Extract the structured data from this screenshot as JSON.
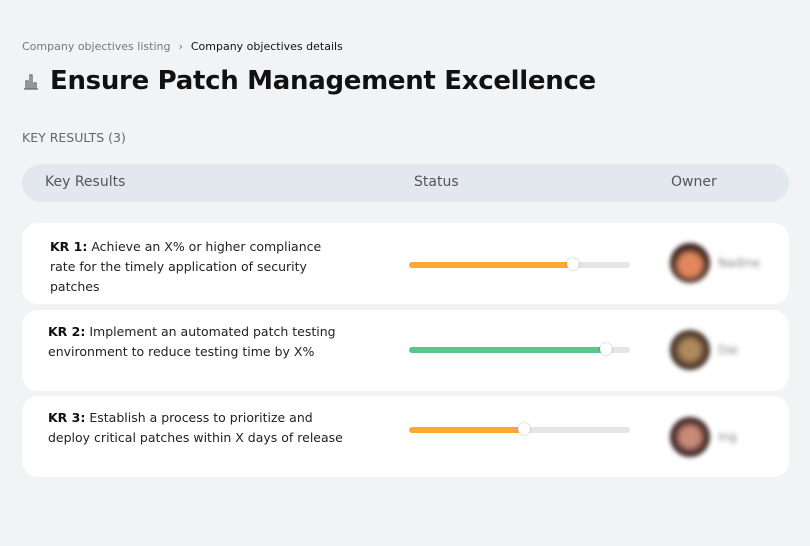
{
  "breadcrumb": {
    "previous": "Company objectives listing",
    "separator": "›",
    "current": "Company objectives details"
  },
  "page": {
    "title": "Ensure Patch Management Excellence",
    "icon": "building-chart-icon"
  },
  "key_results_heading": "KEY RESULTS (3)",
  "table": {
    "headers": {
      "key_results": "Key Results",
      "status": "Status",
      "owner": "Owner"
    },
    "rows": [
      {
        "label": "KR 1:",
        "text": " Achieve an X% or higher compliance rate for the timely application of security patches",
        "progress": 74,
        "color": "#ffa733",
        "owner": "Nadine"
      },
      {
        "label": "KR 2:",
        "text": " Implement an automated patch testing environment to reduce testing time by X%",
        "progress": 89,
        "color": "#58c68d",
        "owner": "Dai"
      },
      {
        "label": "KR 3:",
        "text": " Establish a process to prioritize and deploy critical patches within X days of release",
        "progress": 52,
        "color": "#ffa733",
        "owner": "Ing"
      }
    ]
  }
}
